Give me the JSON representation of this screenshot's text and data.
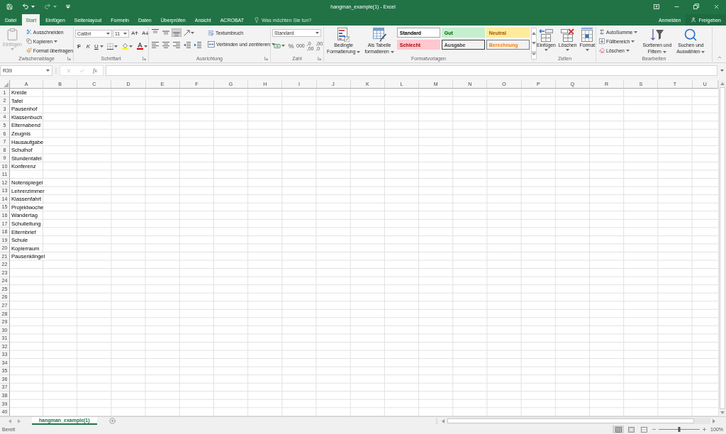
{
  "title_bar": {
    "title": "hangman_example(1) - Excel"
  },
  "quick_access": [
    {
      "kind": "save",
      "disabled": false
    },
    {
      "kind": "undo",
      "disabled": false
    },
    {
      "kind": "redo",
      "disabled": true
    },
    {
      "kind": "customize",
      "disabled": false
    }
  ],
  "tabs": [
    {
      "label": "Datei",
      "selected": false
    },
    {
      "label": "Start",
      "selected": true
    },
    {
      "label": "Einfügen",
      "selected": false
    },
    {
      "label": "Seitenlayout",
      "selected": false
    },
    {
      "label": "Formeln",
      "selected": false
    },
    {
      "label": "Daten",
      "selected": false
    },
    {
      "label": "Überprüfen",
      "selected": false
    },
    {
      "label": "Ansicht",
      "selected": false
    },
    {
      "label": "ACROBAT",
      "selected": false
    }
  ],
  "tell_me": {
    "placeholder": "Was möchten Sie tun?"
  },
  "account": {
    "sign_in": "Anmelden",
    "share": "Freigeben"
  },
  "ribbon": {
    "clipboard": {
      "label": "Zwischenablage",
      "paste": {
        "label": "Einfügen",
        "disabled": true
      },
      "cut": "Ausschneiden",
      "copy": "Kopieren",
      "format_painter": "Format übertragen"
    },
    "font": {
      "label": "Schriftart",
      "font_name": "Calibri",
      "font_size": "11",
      "bold": "F",
      "italic": "K",
      "underline": "U"
    },
    "alignment": {
      "label": "Ausrichtung",
      "vertical": [
        {
          "kind": "top",
          "selected": false
        },
        {
          "kind": "middle",
          "selected": false
        },
        {
          "kind": "bottom",
          "selected": true
        }
      ],
      "horizontal": [
        {
          "kind": "left",
          "selected": false
        },
        {
          "kind": "center",
          "selected": false
        },
        {
          "kind": "right",
          "selected": false
        }
      ],
      "wrap_text": "Textumbruch",
      "merge": "Verbinden und zentrieren"
    },
    "number": {
      "label": "Zahl",
      "format": "Standard",
      "percent": "%",
      "thousands": "000",
      "increase_decimal": [
        ",0",
        ",00"
      ],
      "decrease_decimal": [
        ",00",
        ",0"
      ]
    },
    "styles": {
      "label": "Formatvorlagen",
      "conditional": [
        "Bedingte",
        "Formatierung"
      ],
      "as_table": [
        "Als Tabelle",
        "formatieren"
      ],
      "gallery": [
        {
          "label": "Standard",
          "kind": "normal"
        },
        {
          "label": "Gut",
          "kind": "good"
        },
        {
          "label": "Neutral",
          "kind": "neutral"
        },
        {
          "label": "Schlecht",
          "kind": "bad"
        },
        {
          "label": "Ausgabe",
          "kind": "output"
        },
        {
          "label": "Berechnung",
          "kind": "calculation"
        }
      ]
    },
    "cells": {
      "label": "Zellen",
      "buttons": [
        {
          "kind": "insert",
          "label": "Einfügen"
        },
        {
          "kind": "delete",
          "label": "Löschen"
        },
        {
          "kind": "format",
          "label": "Format"
        }
      ]
    },
    "editing": {
      "label": "Bearbeiten",
      "autosum": "AutoSumme",
      "fill": "Füllbereich",
      "clear": "Löschen",
      "sort": [
        "Sortieren und",
        "Filtern"
      ],
      "find": [
        "Suchen und",
        "Auswählen"
      ]
    }
  },
  "formula_bar": {
    "name_box": "R39",
    "function_label": "fx"
  },
  "sheet": {
    "columns": [
      "A",
      "B",
      "C",
      "D",
      "E",
      "F",
      "G",
      "H",
      "I",
      "J",
      "K",
      "L",
      "M",
      "N",
      "O",
      "P",
      "Q",
      "R",
      "S",
      "T",
      "U"
    ],
    "rows": [
      {
        "header": "1",
        "cells": [
          "Kreide"
        ]
      },
      {
        "header": "2",
        "cells": [
          "Tafel"
        ]
      },
      {
        "header": "3",
        "cells": [
          "Pausenhof"
        ]
      },
      {
        "header": "4",
        "cells": [
          "Klassenbuch"
        ]
      },
      {
        "header": "5",
        "cells": [
          "Elternabend"
        ]
      },
      {
        "header": "6",
        "cells": [
          "Zeugnis"
        ]
      },
      {
        "header": "7",
        "cells": [
          "Hausaufgabe"
        ]
      },
      {
        "header": "8",
        "cells": [
          "Schulhof"
        ]
      },
      {
        "header": "9",
        "cells": [
          "Stundentafel"
        ]
      },
      {
        "header": "10",
        "cells": [
          "Konferenz"
        ]
      },
      {
        "header": "11"
      },
      {
        "header": "12",
        "cells": [
          "Notenspiegel"
        ]
      },
      {
        "header": "13",
        "cells": [
          "Lehrerzimmer"
        ]
      },
      {
        "header": "14",
        "cells": [
          "Klassenfahrt"
        ]
      },
      {
        "header": "15",
        "cells": [
          "Projektwoche"
        ]
      },
      {
        "header": "16",
        "cells": [
          "Wandertag"
        ]
      },
      {
        "header": "17",
        "cells": [
          "Schulleitung"
        ]
      },
      {
        "header": "18",
        "cells": [
          "Elternbrief"
        ]
      },
      {
        "header": "19",
        "cells": [
          "Schule"
        ]
      },
      {
        "header": "20",
        "cells": [
          "Kopierraum"
        ]
      },
      {
        "header": "21",
        "cells": [
          "Pausenklingel"
        ]
      },
      {
        "header": "22"
      },
      {
        "header": "23"
      },
      {
        "header": "24"
      },
      {
        "header": "25"
      },
      {
        "header": "26"
      },
      {
        "header": "27"
      },
      {
        "header": "28"
      },
      {
        "header": "29"
      },
      {
        "header": "30"
      },
      {
        "header": "31"
      },
      {
        "header": "32"
      },
      {
        "header": "33"
      },
      {
        "header": "34"
      },
      {
        "header": "35"
      },
      {
        "header": "36"
      },
      {
        "header": "37"
      },
      {
        "header": "38"
      },
      {
        "header": "39"
      },
      {
        "header": "40"
      }
    ]
  },
  "sheet_tabs": [
    {
      "label": "hangman_example(1)",
      "selected": true
    }
  ],
  "status_bar": {
    "status": "Bereit",
    "views": [
      {
        "kind": "normal",
        "selected": true
      },
      {
        "kind": "page_layout",
        "selected": false
      },
      {
        "kind": "page_break",
        "selected": false
      }
    ],
    "zoom": {
      "level": 0.5,
      "reading": "100%"
    }
  }
}
